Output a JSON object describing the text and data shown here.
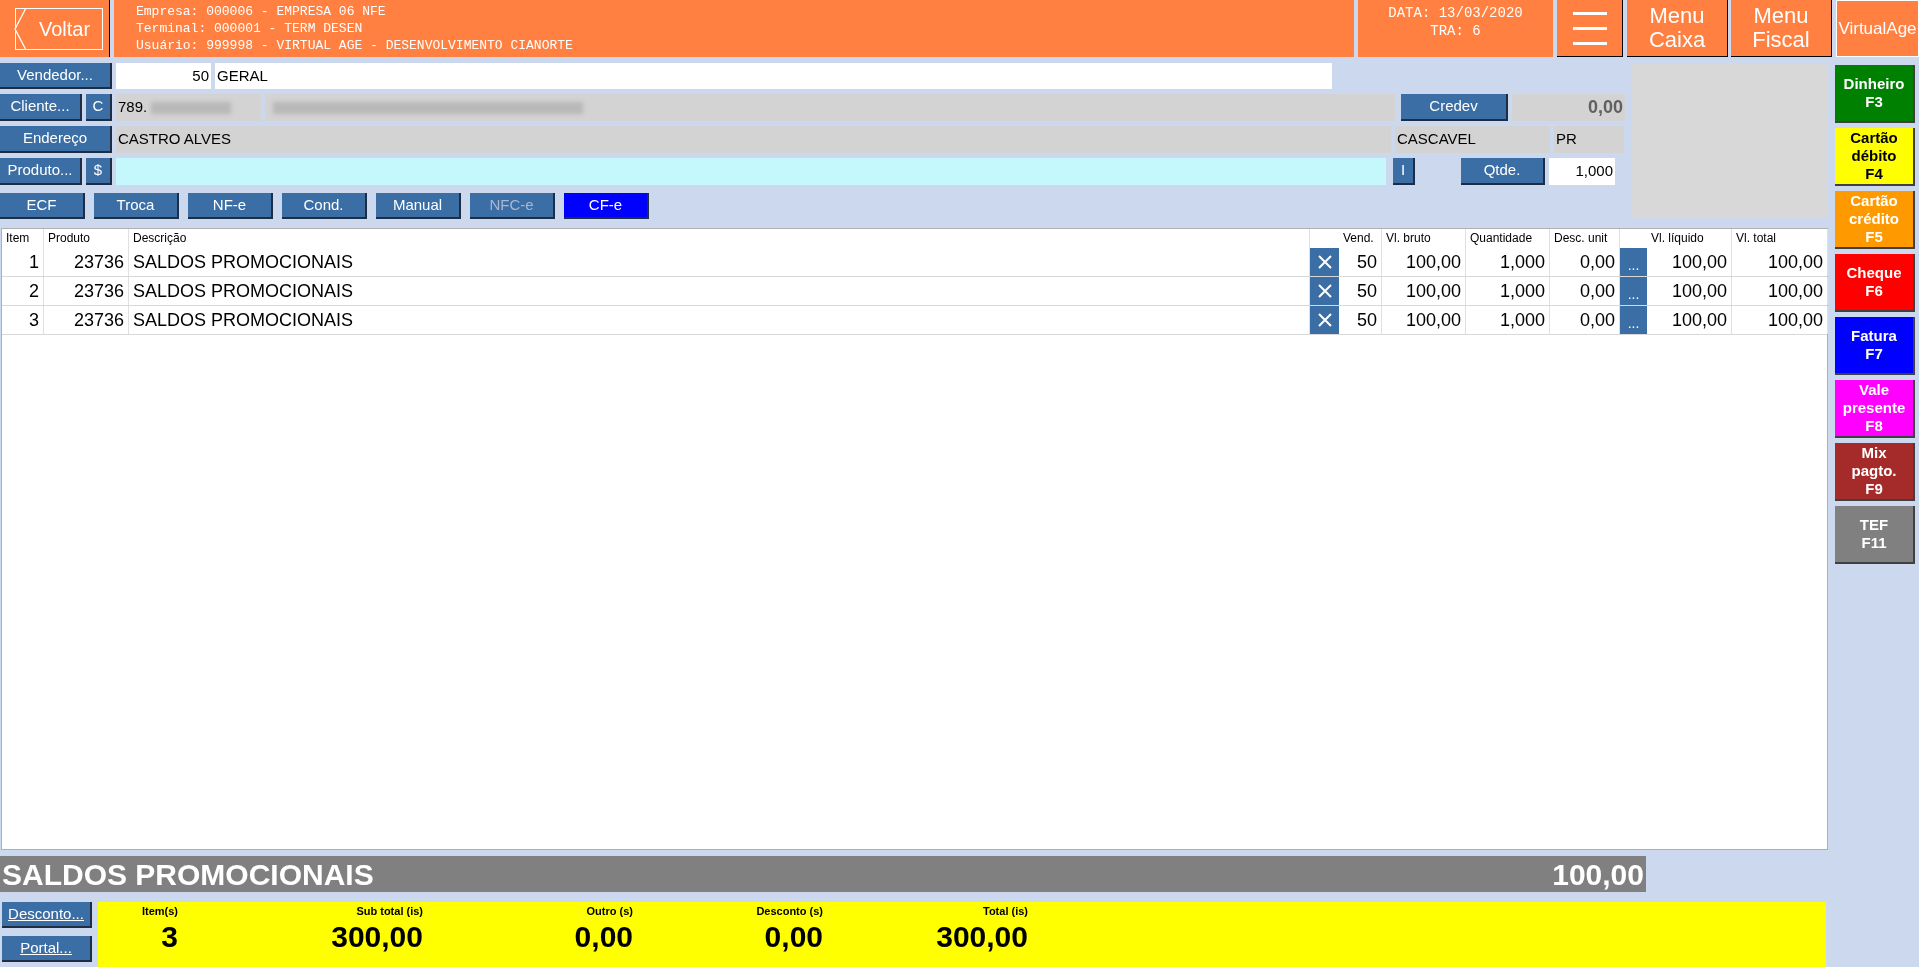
{
  "header": {
    "back_button": "Voltar",
    "info_lines": [
      "Empresa: 000006 - EMPRESA 06 NFE",
      "Terminal: 000001 - TERM DESEN",
      "Usuário: 999998 - VIRTUAL AGE - DESENVOLVIMENTO CIANORTE"
    ],
    "date": "DATA: 13/03/2020",
    "tra": "TRA: 6",
    "menu_buttons": [
      "Menu Caixa",
      "Menu Fiscal"
    ],
    "brand_button": "VirtualAge"
  },
  "form": {
    "vendedor_button": "Vendedor...",
    "vendedor_code": "50",
    "vendedor_name": "GERAL",
    "cliente_button": "Cliente...",
    "cliente_c_button": "C",
    "cliente_code": "789.",
    "credev_button": "Credev",
    "credev_value": "0,00",
    "endereco_button": "Endereço",
    "endereco": "CASTRO ALVES",
    "cidade": "CASCAVEL",
    "uf": "PR",
    "produto_button": "Produto...",
    "price_button": "$",
    "i_button": "I",
    "qtde_button": "Qtde.",
    "qtde": "1,000"
  },
  "tabs": [
    {
      "label": "ECF",
      "selected": false,
      "disabled": false
    },
    {
      "label": "Troca",
      "selected": false,
      "disabled": false
    },
    {
      "label": "NF-e",
      "selected": false,
      "disabled": false
    },
    {
      "label": "Cond.",
      "selected": false,
      "disabled": false
    },
    {
      "label": "Manual",
      "selected": false,
      "disabled": false
    },
    {
      "label": "NFC-e",
      "selected": false,
      "disabled": true
    },
    {
      "label": "CF-e",
      "selected": true,
      "disabled": false
    }
  ],
  "table": {
    "columns": [
      "Item",
      "Produto",
      "Descrição",
      "Vend.",
      "Vl. bruto",
      "Quantidade",
      "Desc. unit",
      "Vl. líquido",
      "Vl. total"
    ],
    "rows": [
      {
        "item": "1",
        "produto": "23736",
        "descricao": "SALDOS PROMOCIONAIS",
        "vend": "50",
        "bruto": "100,00",
        "qtd": "1,000",
        "desc": "0,00",
        "liquido": "100,00",
        "total": "100,00"
      },
      {
        "item": "2",
        "produto": "23736",
        "descricao": "SALDOS PROMOCIONAIS",
        "vend": "50",
        "bruto": "100,00",
        "qtd": "1,000",
        "desc": "0,00",
        "liquido": "100,00",
        "total": "100,00"
      },
      {
        "item": "3",
        "produto": "23736",
        "descricao": "SALDOS PROMOCIONAIS",
        "vend": "50",
        "bruto": "100,00",
        "qtd": "1,000",
        "desc": "0,00",
        "liquido": "100,00",
        "total": "100,00"
      }
    ],
    "more_button": "..."
  },
  "current_item": {
    "name": "SALDOS PROMOCIONAIS",
    "value": "100,00"
  },
  "bottom_buttons": [
    "Desconto...",
    "Portal..."
  ],
  "totals": [
    {
      "label": "Item(s)",
      "value": "3"
    },
    {
      "label": "Sub total (is)",
      "value": "300,00"
    },
    {
      "label": "Outro (s)",
      "value": "0,00"
    },
    {
      "label": "Desconto (s)",
      "value": "0,00"
    },
    {
      "label": "Total (is)",
      "value": "300,00"
    }
  ],
  "payments": [
    {
      "lines": [
        "Dinheiro",
        "F3"
      ],
      "color": "#008000"
    },
    {
      "lines": [
        "Cartão",
        "débito",
        "F4"
      ],
      "color": "#ffff00"
    },
    {
      "lines": [
        "Cartão",
        "crédito",
        "F5"
      ],
      "color": "#ff9900"
    },
    {
      "lines": [
        "Cheque",
        "F6"
      ],
      "color": "#ff0000"
    },
    {
      "lines": [
        "Fatura",
        "F7"
      ],
      "color": "#0000ff"
    },
    {
      "lines": [
        "Vale",
        "presente",
        "F8"
      ],
      "color": "#ff00ff"
    },
    {
      "lines": [
        "Mix",
        "pagto.",
        "F9"
      ],
      "color": "#a52a2a"
    },
    {
      "lines": [
        "TEF",
        "F11"
      ],
      "color": "#808080"
    }
  ]
}
